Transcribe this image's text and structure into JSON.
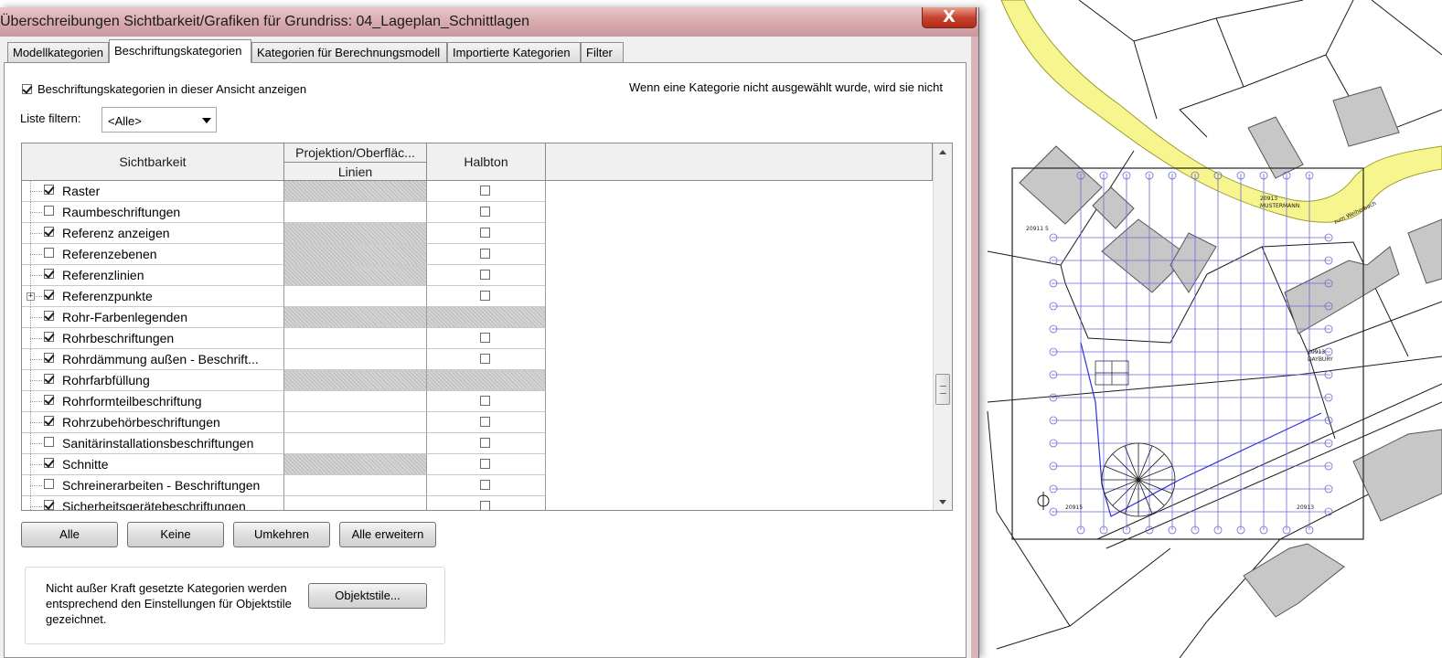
{
  "dialog": {
    "title": "Überschreibungen Sichtbarkeit/Grafiken für Grundriss: 04_Lageplan_Schnittlagen",
    "close_label": "X"
  },
  "tabs": [
    {
      "label": "Modellkategorien",
      "active": false
    },
    {
      "label": "Beschriftungskategorien",
      "active": true
    },
    {
      "label": "Kategorien für Berechnungsmodell",
      "active": false
    },
    {
      "label": "Importierte Kategorien",
      "active": false
    },
    {
      "label": "Filter",
      "active": false
    }
  ],
  "show_categories": {
    "label": "Beschriftungskategorien in dieser Ansicht anzeigen",
    "checked": true
  },
  "hint_text": "Wenn eine Kategorie nicht ausgewählt wurde, wird sie nicht",
  "filter": {
    "label": "Liste filtern:",
    "value": "<Alle>"
  },
  "table": {
    "headers": {
      "visibility": "Sichtbarkeit",
      "projection": "Projektion/Oberfläc...",
      "lines": "Linien",
      "halftone": "Halbton"
    },
    "rows": [
      {
        "name": "Raster",
        "checked": true,
        "lines_hatched": true,
        "halftone_hatched": false,
        "halftone_checked": false,
        "expandable": false
      },
      {
        "name": "Raumbeschriftungen",
        "checked": false,
        "lines_hatched": false,
        "halftone_hatched": false,
        "halftone_checked": false,
        "expandable": false
      },
      {
        "name": "Referenz anzeigen",
        "checked": true,
        "lines_hatched": true,
        "halftone_hatched": false,
        "halftone_checked": false,
        "expandable": false
      },
      {
        "name": "Referenzebenen",
        "checked": false,
        "lines_hatched": true,
        "halftone_hatched": false,
        "halftone_checked": false,
        "expandable": false
      },
      {
        "name": "Referenzlinien",
        "checked": true,
        "lines_hatched": true,
        "halftone_hatched": false,
        "halftone_checked": false,
        "expandable": false
      },
      {
        "name": "Referenzpunkte",
        "checked": true,
        "lines_hatched": false,
        "halftone_hatched": false,
        "halftone_checked": false,
        "expandable": true
      },
      {
        "name": "Rohr-Farbenlegenden",
        "checked": true,
        "lines_hatched": true,
        "halftone_hatched": true,
        "halftone_checked": false,
        "expandable": false
      },
      {
        "name": "Rohrbeschriftungen",
        "checked": true,
        "lines_hatched": false,
        "halftone_hatched": false,
        "halftone_checked": false,
        "expandable": false
      },
      {
        "name": "Rohrdämmung außen - Beschrift...",
        "checked": true,
        "lines_hatched": false,
        "halftone_hatched": false,
        "halftone_checked": false,
        "expandable": false
      },
      {
        "name": "Rohrfarbfüllung",
        "checked": true,
        "lines_hatched": true,
        "halftone_hatched": true,
        "halftone_checked": false,
        "expandable": false
      },
      {
        "name": "Rohrformteilbeschriftung",
        "checked": true,
        "lines_hatched": false,
        "halftone_hatched": false,
        "halftone_checked": false,
        "expandable": false
      },
      {
        "name": "Rohrzubehörbeschriftungen",
        "checked": true,
        "lines_hatched": false,
        "halftone_hatched": false,
        "halftone_checked": false,
        "expandable": false
      },
      {
        "name": "Sanitärinstallationsbeschriftungen",
        "checked": false,
        "lines_hatched": false,
        "halftone_hatched": false,
        "halftone_checked": false,
        "expandable": false
      },
      {
        "name": "Schnitte",
        "checked": true,
        "lines_hatched": true,
        "halftone_hatched": false,
        "halftone_checked": false,
        "expandable": false
      },
      {
        "name": "Schreinerarbeiten - Beschriftungen",
        "checked": false,
        "lines_hatched": false,
        "halftone_hatched": false,
        "halftone_checked": false,
        "expandable": false
      },
      {
        "name": "Sicherheitsgerätebeschriftungen",
        "checked": true,
        "lines_hatched": false,
        "halftone_hatched": false,
        "halftone_checked": false,
        "expandable": false
      }
    ]
  },
  "buttons": {
    "all": "Alle",
    "none": "Keine",
    "invert": "Umkehren",
    "expand_all": "Alle erweitern",
    "object_styles": "Objektstile..."
  },
  "info_text": "Nicht außer Kraft gesetzte Kategorien werden entsprechend den Einstellungen für Objektstile gezeichnet.",
  "map": {
    "labels": {
      "label1": "20913",
      "label2": "MUSTERMANN",
      "label3": "zum Weiherbach",
      "label4": "20911 5",
      "label5": "20913",
      "label6": "DAYBURY",
      "label7": "20915",
      "label8": "20913"
    },
    "colors": {
      "road": "#f7f58d",
      "road_edge": "#c9c84a",
      "grid": "#5a5ad0",
      "pipe": "#2f2fd8",
      "building": "#c7c7c7"
    }
  }
}
